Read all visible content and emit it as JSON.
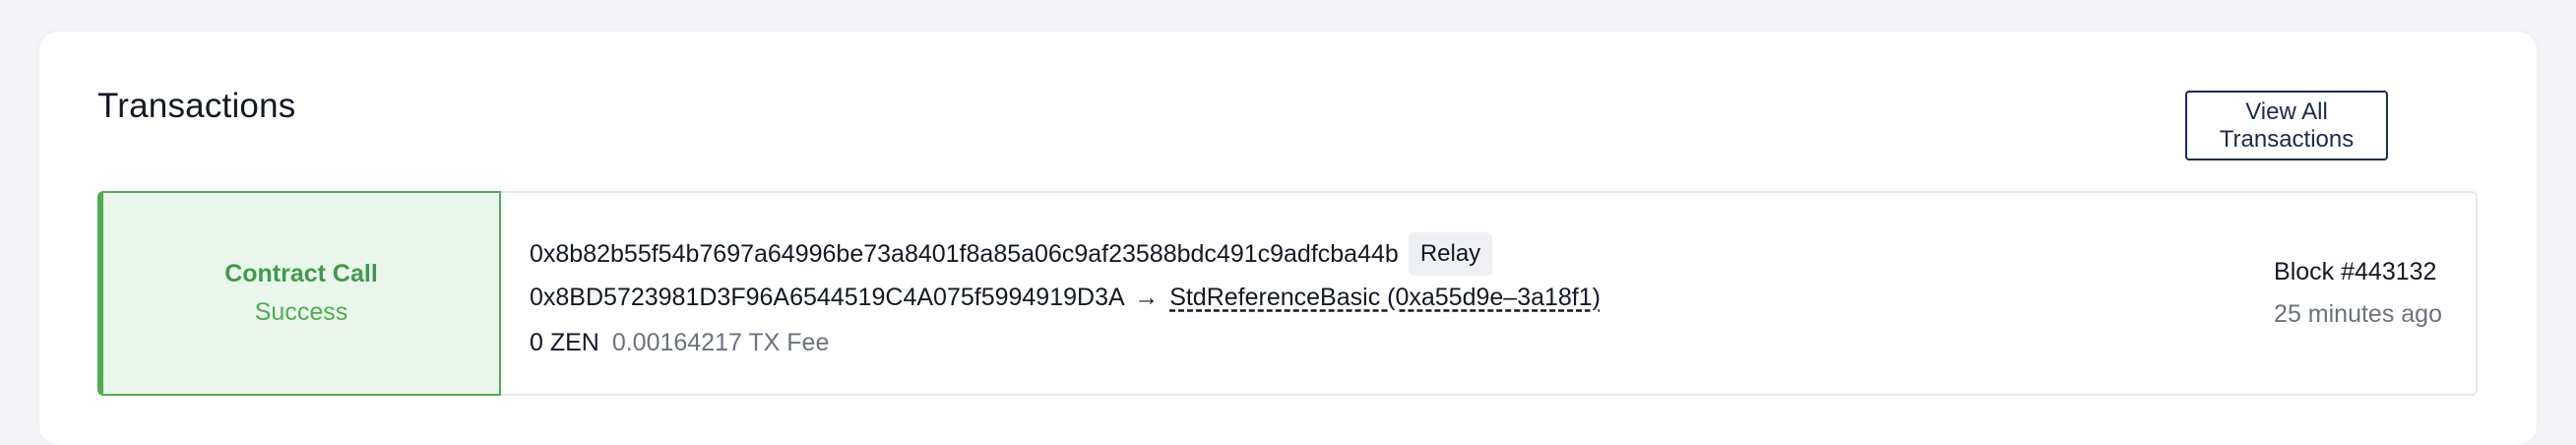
{
  "section": {
    "title": "Transactions",
    "view_all_label": "View All Transactions"
  },
  "transaction": {
    "type": "Contract Call",
    "status": "Success",
    "status_color": "#4caf50",
    "hash": "0x8b82b55f54b7697a64996be73a8401f8a85a06c9af23588bdc491c9adfcba44b",
    "tag": "Relay",
    "from": "0x8BD5723981D3F96A6544519C4A075f5994919D3A",
    "arrow": "→",
    "to": "StdReferenceBasic (0xa55d9e–3a18f1)",
    "amount": "0 ZEN",
    "fee": "0.00164217 TX Fee",
    "block": "Block #443132",
    "time_ago": "25 minutes ago"
  }
}
